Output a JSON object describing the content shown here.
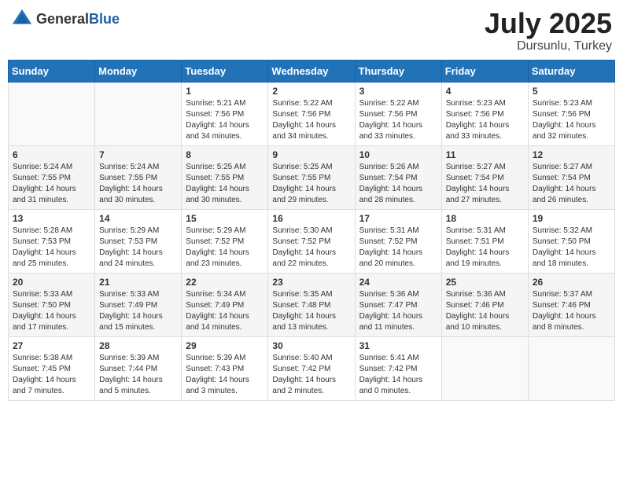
{
  "header": {
    "logo_general": "General",
    "logo_blue": "Blue",
    "month_year": "July 2025",
    "location": "Dursunlu, Turkey"
  },
  "weekdays": [
    "Sunday",
    "Monday",
    "Tuesday",
    "Wednesday",
    "Thursday",
    "Friday",
    "Saturday"
  ],
  "weeks": [
    [
      {
        "day": "",
        "info": ""
      },
      {
        "day": "",
        "info": ""
      },
      {
        "day": "1",
        "info": "Sunrise: 5:21 AM\nSunset: 7:56 PM\nDaylight: 14 hours and 34 minutes."
      },
      {
        "day": "2",
        "info": "Sunrise: 5:22 AM\nSunset: 7:56 PM\nDaylight: 14 hours and 34 minutes."
      },
      {
        "day": "3",
        "info": "Sunrise: 5:22 AM\nSunset: 7:56 PM\nDaylight: 14 hours and 33 minutes."
      },
      {
        "day": "4",
        "info": "Sunrise: 5:23 AM\nSunset: 7:56 PM\nDaylight: 14 hours and 33 minutes."
      },
      {
        "day": "5",
        "info": "Sunrise: 5:23 AM\nSunset: 7:56 PM\nDaylight: 14 hours and 32 minutes."
      }
    ],
    [
      {
        "day": "6",
        "info": "Sunrise: 5:24 AM\nSunset: 7:55 PM\nDaylight: 14 hours and 31 minutes."
      },
      {
        "day": "7",
        "info": "Sunrise: 5:24 AM\nSunset: 7:55 PM\nDaylight: 14 hours and 30 minutes."
      },
      {
        "day": "8",
        "info": "Sunrise: 5:25 AM\nSunset: 7:55 PM\nDaylight: 14 hours and 30 minutes."
      },
      {
        "day": "9",
        "info": "Sunrise: 5:25 AM\nSunset: 7:55 PM\nDaylight: 14 hours and 29 minutes."
      },
      {
        "day": "10",
        "info": "Sunrise: 5:26 AM\nSunset: 7:54 PM\nDaylight: 14 hours and 28 minutes."
      },
      {
        "day": "11",
        "info": "Sunrise: 5:27 AM\nSunset: 7:54 PM\nDaylight: 14 hours and 27 minutes."
      },
      {
        "day": "12",
        "info": "Sunrise: 5:27 AM\nSunset: 7:54 PM\nDaylight: 14 hours and 26 minutes."
      }
    ],
    [
      {
        "day": "13",
        "info": "Sunrise: 5:28 AM\nSunset: 7:53 PM\nDaylight: 14 hours and 25 minutes."
      },
      {
        "day": "14",
        "info": "Sunrise: 5:29 AM\nSunset: 7:53 PM\nDaylight: 14 hours and 24 minutes."
      },
      {
        "day": "15",
        "info": "Sunrise: 5:29 AM\nSunset: 7:52 PM\nDaylight: 14 hours and 23 minutes."
      },
      {
        "day": "16",
        "info": "Sunrise: 5:30 AM\nSunset: 7:52 PM\nDaylight: 14 hours and 22 minutes."
      },
      {
        "day": "17",
        "info": "Sunrise: 5:31 AM\nSunset: 7:52 PM\nDaylight: 14 hours and 20 minutes."
      },
      {
        "day": "18",
        "info": "Sunrise: 5:31 AM\nSunset: 7:51 PM\nDaylight: 14 hours and 19 minutes."
      },
      {
        "day": "19",
        "info": "Sunrise: 5:32 AM\nSunset: 7:50 PM\nDaylight: 14 hours and 18 minutes."
      }
    ],
    [
      {
        "day": "20",
        "info": "Sunrise: 5:33 AM\nSunset: 7:50 PM\nDaylight: 14 hours and 17 minutes."
      },
      {
        "day": "21",
        "info": "Sunrise: 5:33 AM\nSunset: 7:49 PM\nDaylight: 14 hours and 15 minutes."
      },
      {
        "day": "22",
        "info": "Sunrise: 5:34 AM\nSunset: 7:49 PM\nDaylight: 14 hours and 14 minutes."
      },
      {
        "day": "23",
        "info": "Sunrise: 5:35 AM\nSunset: 7:48 PM\nDaylight: 14 hours and 13 minutes."
      },
      {
        "day": "24",
        "info": "Sunrise: 5:36 AM\nSunset: 7:47 PM\nDaylight: 14 hours and 11 minutes."
      },
      {
        "day": "25",
        "info": "Sunrise: 5:36 AM\nSunset: 7:46 PM\nDaylight: 14 hours and 10 minutes."
      },
      {
        "day": "26",
        "info": "Sunrise: 5:37 AM\nSunset: 7:46 PM\nDaylight: 14 hours and 8 minutes."
      }
    ],
    [
      {
        "day": "27",
        "info": "Sunrise: 5:38 AM\nSunset: 7:45 PM\nDaylight: 14 hours and 7 minutes."
      },
      {
        "day": "28",
        "info": "Sunrise: 5:39 AM\nSunset: 7:44 PM\nDaylight: 14 hours and 5 minutes."
      },
      {
        "day": "29",
        "info": "Sunrise: 5:39 AM\nSunset: 7:43 PM\nDaylight: 14 hours and 3 minutes."
      },
      {
        "day": "30",
        "info": "Sunrise: 5:40 AM\nSunset: 7:42 PM\nDaylight: 14 hours and 2 minutes."
      },
      {
        "day": "31",
        "info": "Sunrise: 5:41 AM\nSunset: 7:42 PM\nDaylight: 14 hours and 0 minutes."
      },
      {
        "day": "",
        "info": ""
      },
      {
        "day": "",
        "info": ""
      }
    ]
  ]
}
